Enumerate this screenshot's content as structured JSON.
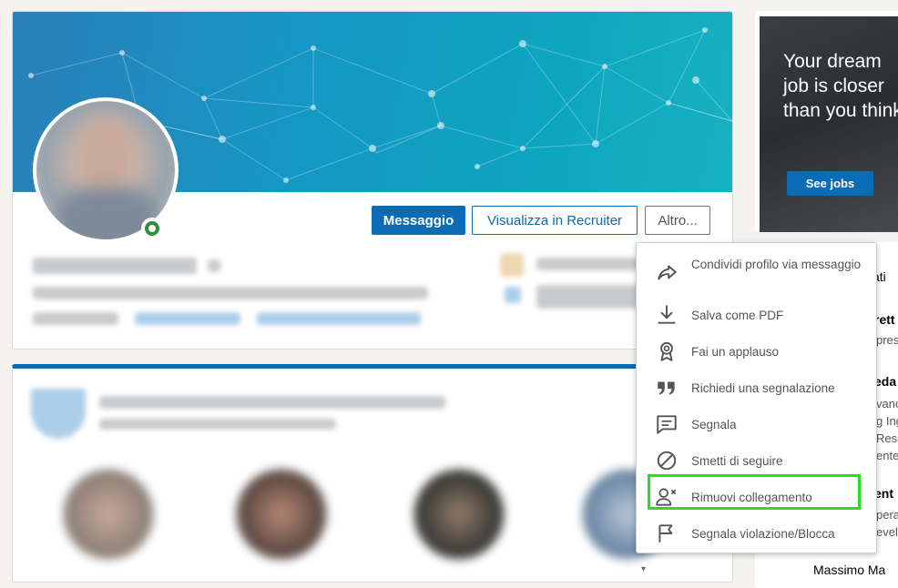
{
  "profile": {
    "actions": {
      "message": "Messaggio",
      "recruiter": "Visualizza in Recruiter",
      "more": "Altro..."
    }
  },
  "ad": {
    "headline": "Your dream job is closer than you think",
    "cta": "See jobs"
  },
  "more_menu": {
    "items": [
      {
        "label": "Condividi profilo via messaggio",
        "icon": "share-arrow-icon"
      },
      {
        "label": "Salva come PDF",
        "icon": "download-icon"
      },
      {
        "label": "Fai un applauso",
        "icon": "award-ribbon-icon"
      },
      {
        "label": "Richiedi una segnalazione",
        "icon": "quote-icon"
      },
      {
        "label": "Segnala",
        "icon": "message-report-icon"
      },
      {
        "label": "Smetti di seguire",
        "icon": "block-circle-icon"
      },
      {
        "label": "Rimuovi collegamento",
        "icon": "remove-person-icon"
      },
      {
        "label": "Segnala violazione/Blocca",
        "icon": "flag-icon"
      }
    ],
    "highlighted_index": 6,
    "highlight_color": "#22e11e"
  },
  "sidebar": {
    "fragments": [
      "ati",
      "rett",
      "pres",
      "eda",
      "vanc",
      "g Ing",
      "Rese",
      "ente",
      "ent",
      "pera",
      "evelo",
      "Massimo Ma"
    ]
  },
  "colors": {
    "accent": "#0b6bb5",
    "online_status": "#2f8f3a"
  }
}
